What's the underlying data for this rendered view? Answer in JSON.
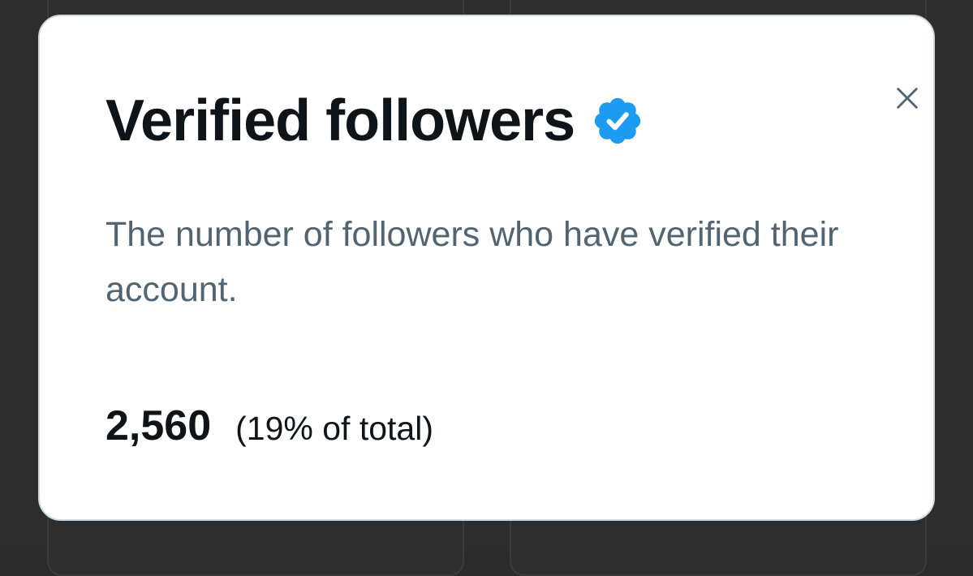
{
  "modal": {
    "title": "Verified followers",
    "badge_icon": "verified-badge-icon",
    "badge_color": "#1d9bf0",
    "description": "The number of followers who have verified their account.",
    "stat_value": "2,560",
    "stat_percentage": "(19% of total)",
    "close_icon": "close-icon"
  }
}
